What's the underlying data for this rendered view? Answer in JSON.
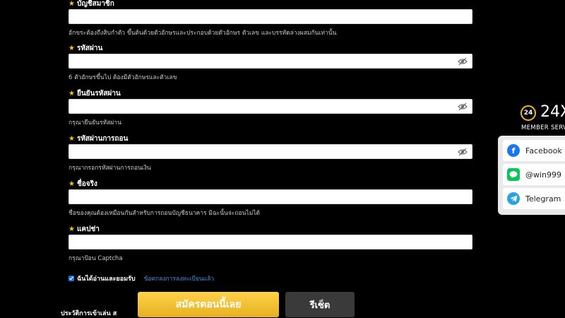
{
  "fields": [
    {
      "label": "บัญชีสมาชิก",
      "hint": "อักขระต้องถึงสิบกำตัว ขึ้นต้นด้วยตัวอักษรและประกอบด้วยตัวอักษร ตัวเลข และบรรทัดล่างผสมกันเท่านั้น",
      "has_eye": false
    },
    {
      "label": "รหัสผ่าน",
      "hint": "6 ตัวอักษรขึ้นไป ต้องมีตัวอักษรและตัวเลข",
      "has_eye": true
    },
    {
      "label": "ยืนยันรหัสผ่าน",
      "hint": "กรุณายืนยันรหัสผ่าน",
      "has_eye": true
    },
    {
      "label": "รหัสผ่านการถอน",
      "hint": "กรุณากรอกรหัสผ่านการถอนเงิน",
      "has_eye": true
    },
    {
      "label": "ชื่อจริง",
      "hint": "ชื่อของคุณต้องเหมือนกันสำหรับการถอนบัญชีธนาคาร มิฉะนั้นจะถอนไม่ได้",
      "has_eye": false
    },
    {
      "label": "แคปช่า",
      "hint": "กรุณาป้อน Captcha",
      "has_eye": false
    }
  ],
  "agree": {
    "checked": true,
    "text": "ฉันได้อ่านและยอมรับ",
    "link": "ข้อตกลงการลงทะเบียนแล้ว"
  },
  "buttons": {
    "submit": "สมัครตอนนี้เลย",
    "reset": "รีเซ็ต"
  },
  "bottom_text": "ประวัติการเข้าเล่น ส",
  "support": {
    "badge": "24",
    "big": "24X",
    "member": "MEMBER SERV",
    "contacts": [
      {
        "icon": "facebook-icon",
        "label": "Facebook"
      },
      {
        "icon": "line-icon",
        "label": "@win999"
      },
      {
        "icon": "telegram-icon",
        "label": "Telegram"
      }
    ]
  },
  "colors": {
    "accent_gold": "#f5c518",
    "link_blue": "#4a90e2",
    "facebook": "#1877f2",
    "line": "#06c755",
    "telegram": "#2aa3de"
  }
}
